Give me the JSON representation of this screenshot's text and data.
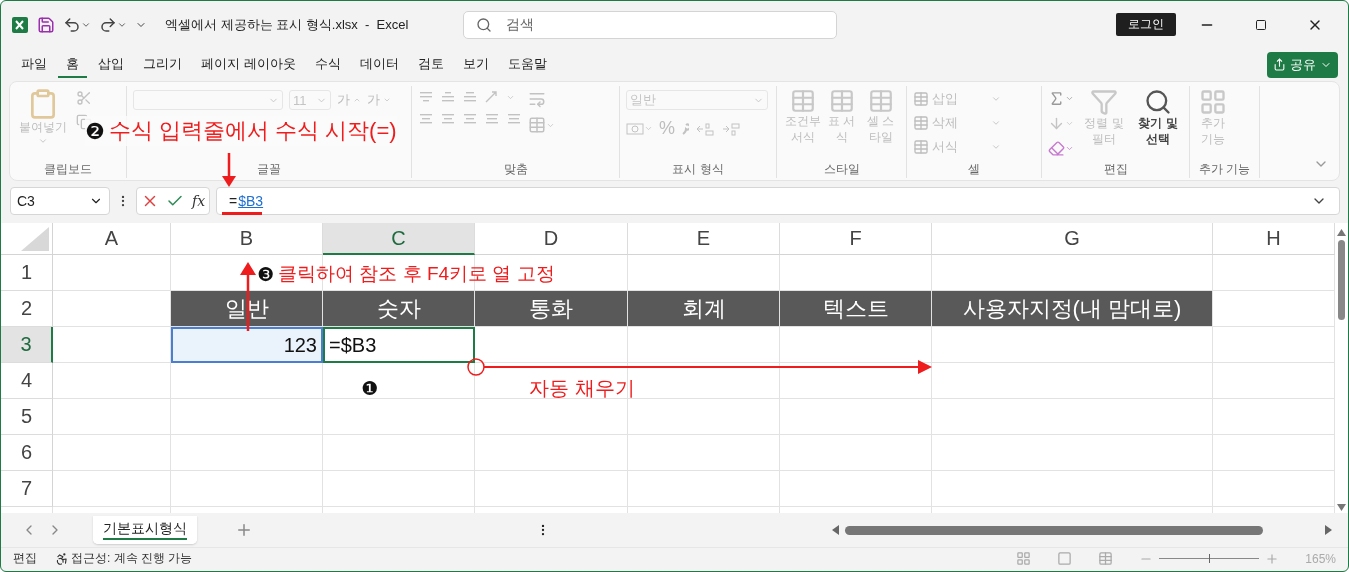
{
  "title_bar": {
    "title": "엑셀에서 제공하는 표시 형식.xlsx  -  Excel",
    "search_placeholder": "검색",
    "login_button": "로그인"
  },
  "menu_tabs": [
    {
      "label": "파일",
      "selected": false
    },
    {
      "label": "홈",
      "selected": true
    },
    {
      "label": "삽입",
      "selected": false
    },
    {
      "label": "그리기",
      "selected": false
    },
    {
      "label": "페이지 레이아웃",
      "selected": false
    },
    {
      "label": "수식",
      "selected": false
    },
    {
      "label": "데이터",
      "selected": false
    },
    {
      "label": "검토",
      "selected": false
    },
    {
      "label": "보기",
      "selected": false
    },
    {
      "label": "도움말",
      "selected": false
    }
  ],
  "share_button": "공유",
  "ribbon": {
    "clipboard": {
      "label": "클립보드",
      "paste": {
        "label": "붙여넣기",
        "disabled": true
      }
    },
    "font": {
      "label": "글꼴",
      "font_size": "11",
      "grow": "가",
      "shrink": "가",
      "disabled": true
    },
    "alignment": {
      "label": "맞춤",
      "disabled": true
    },
    "number": {
      "label": "표시 형식",
      "format": "일반",
      "percent": "%",
      "disabled": true
    },
    "styles": {
      "label": "스타일",
      "buttons": [
        {
          "label": "조건부 서식",
          "disabled": true
        },
        {
          "label": "표 서식",
          "disabled": true
        },
        {
          "label": "셀 스타일",
          "disabled": true
        }
      ]
    },
    "cells": {
      "label": "셀",
      "buttons": [
        {
          "label": "삽입",
          "disabled": true
        },
        {
          "label": "삭제",
          "disabled": true
        },
        {
          "label": "서식",
          "disabled": true
        }
      ]
    },
    "editing": {
      "label": "편집",
      "buttons": [
        {
          "label": "정렬 및 필터",
          "disabled": true
        },
        {
          "label": "찾기 및 선택",
          "disabled": false
        }
      ]
    },
    "addins": {
      "label": "추가 기능",
      "buttons": [
        {
          "label": "추가 기능",
          "disabled": true
        }
      ]
    }
  },
  "formula_bar": {
    "name_box": "C3",
    "function_label": "fx",
    "formula_prefix": "=",
    "formula_reference": "$B3"
  },
  "sheet": {
    "columns": [
      {
        "label": "A",
        "selected": false
      },
      {
        "label": "B",
        "selected": false
      },
      {
        "label": "C",
        "selected": true
      },
      {
        "label": "D",
        "selected": false
      },
      {
        "label": "E",
        "selected": false
      },
      {
        "label": "F",
        "selected": false
      },
      {
        "label": "G",
        "selected": false
      },
      {
        "label": "H",
        "selected": false
      }
    ],
    "rows": [
      {
        "label": "1",
        "selected": false
      },
      {
        "label": "2",
        "selected": false,
        "cells": [
          {
            "kind": "blank"
          },
          {
            "text": "일반",
            "kind": "header"
          },
          {
            "text": "숫자",
            "kind": "header"
          },
          {
            "text": "통화",
            "kind": "header"
          },
          {
            "text": "회계",
            "kind": "header"
          },
          {
            "text": "텍스트",
            "kind": "header"
          },
          {
            "text": "사용자지정(내 맘대로)",
            "kind": "header"
          }
        ]
      },
      {
        "label": "3",
        "selected": true,
        "cells": [
          {
            "kind": "blank"
          },
          {
            "text": "123",
            "kind": "referenced"
          },
          {
            "text": "=$B3",
            "kind": "editing"
          }
        ]
      },
      {
        "label": "4",
        "selected": false
      },
      {
        "label": "5",
        "selected": false
      },
      {
        "label": "6",
        "selected": false
      },
      {
        "label": "7",
        "selected": false
      }
    ]
  },
  "sheet_tabs": [
    {
      "label": "기본표시형식",
      "selected": true
    }
  ],
  "status_bar": {
    "mode": "편집",
    "accessibility": "접근성: 계속 진행 가능",
    "zoom": "165%",
    "zoom_slider": {
      "level": 0.5
    }
  },
  "annotations": [
    {
      "marker": "❷",
      "text": "수식 입력줄에서 수식 시작(=)"
    },
    {
      "marker": "❸",
      "text": "클릭하여 참조 후 F4키로 열 고정"
    },
    {
      "marker": "❶"
    },
    {
      "text": "자동 채우기"
    }
  ]
}
